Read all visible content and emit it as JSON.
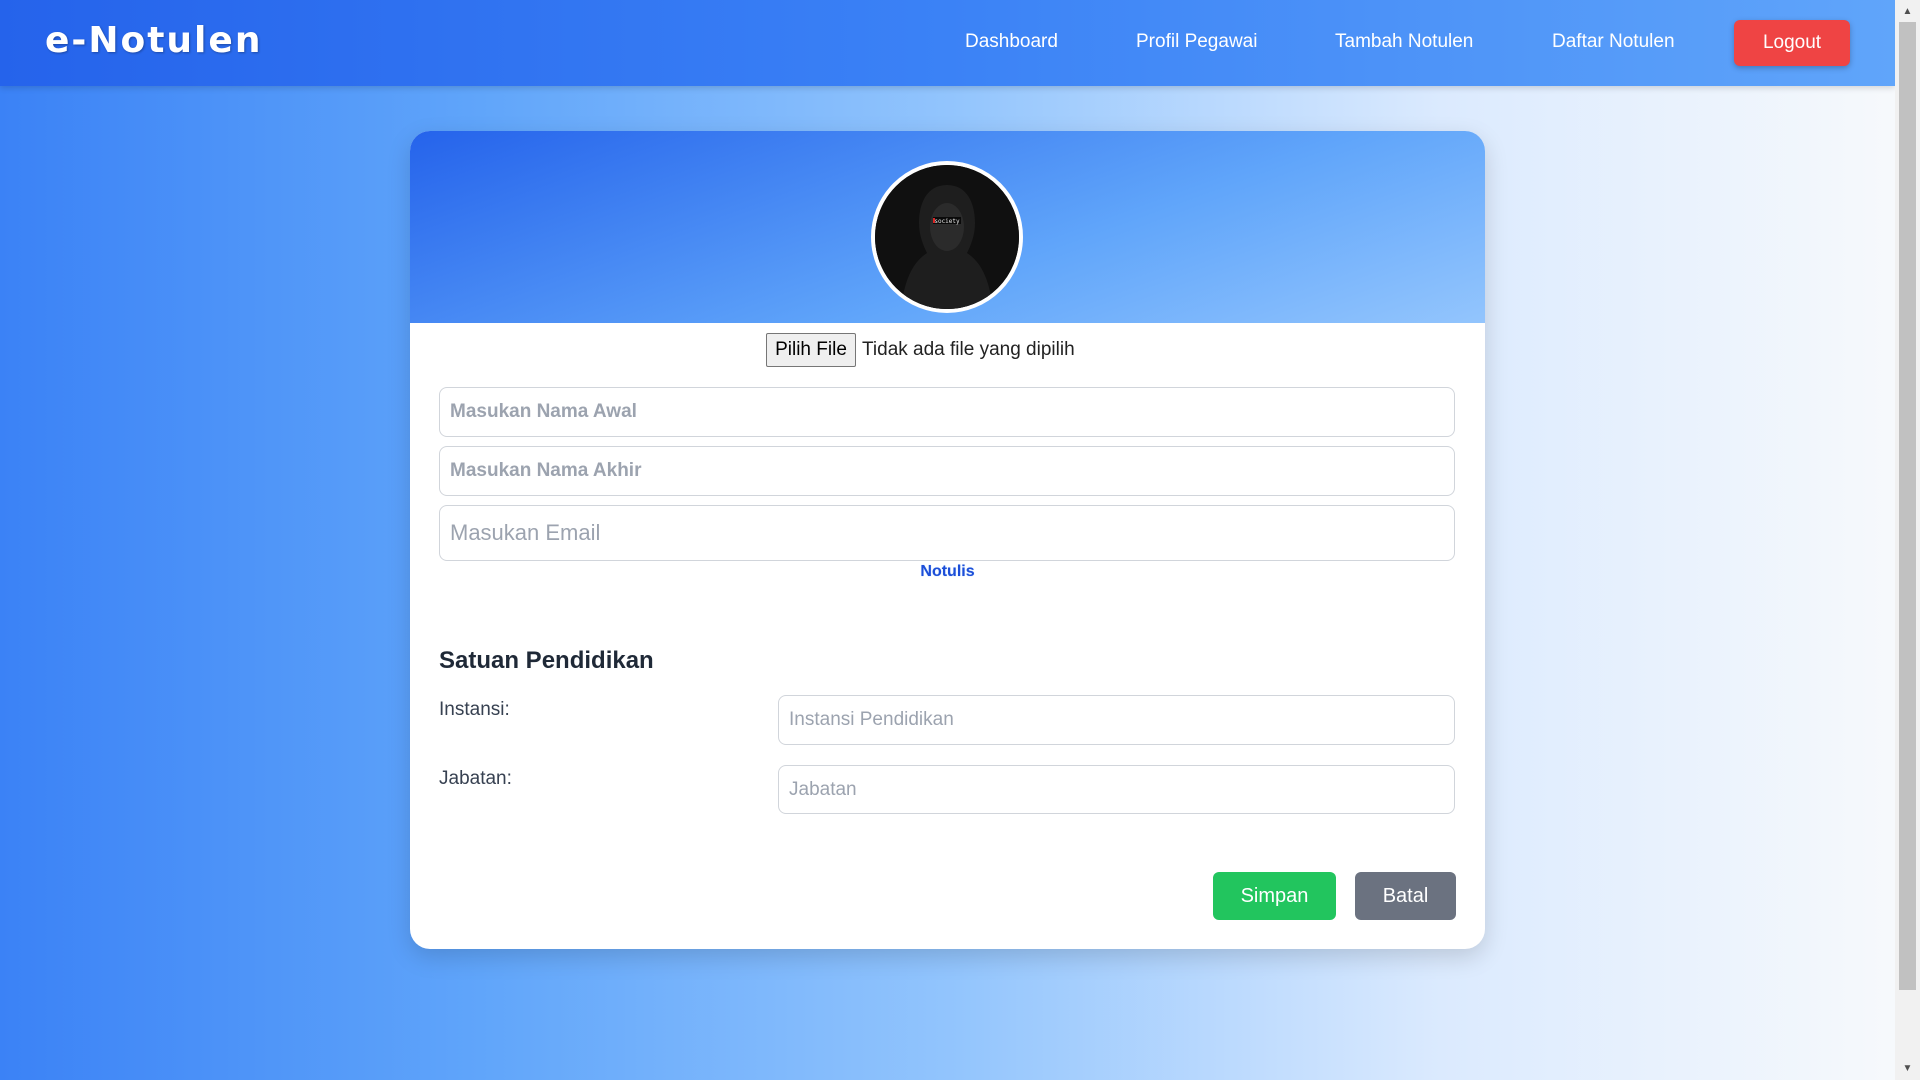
{
  "navbar": {
    "brand": "e-Notulen",
    "links": [
      "Dashboard",
      "Profil Pegawai",
      "Tambah Notulen",
      "Daftar Notulen"
    ],
    "logout": "Logout"
  },
  "profile": {
    "avatar_text": "society",
    "file_button": "Pilih File",
    "file_status": "Tidak ada file yang dipilih",
    "first_name_placeholder": "Masukan Nama Awal",
    "last_name_placeholder": "Masukan Nama Akhir",
    "email_placeholder": "Masukan Email",
    "role": "Notulis"
  },
  "education": {
    "title": "Satuan Pendidikan",
    "instansi_label": "Instansi:",
    "instansi_placeholder": "Instansi Pendidikan",
    "jabatan_label": "Jabatan:",
    "jabatan_placeholder": "Jabatan"
  },
  "actions": {
    "save": "Simpan",
    "cancel": "Batal"
  },
  "colors": {
    "primary": "#2563eb",
    "danger": "#ef4444",
    "success": "#22c55e",
    "secondary": "#6b7280"
  }
}
